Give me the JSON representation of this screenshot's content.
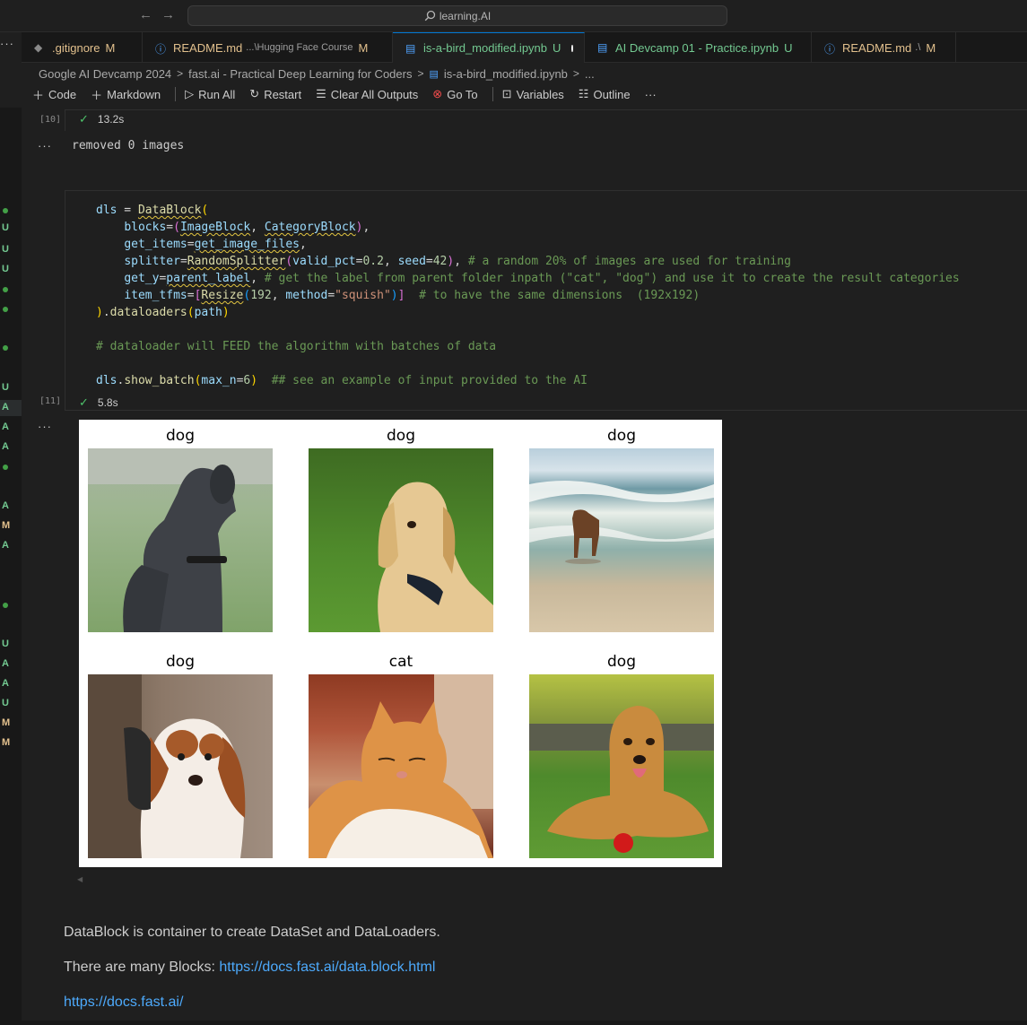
{
  "titlebar": {
    "back_arrow": "←",
    "forward_arrow": "→",
    "search_text": "learning.AI",
    "more": "···"
  },
  "tabs": [
    {
      "icon": "git-icon",
      "name": ".gitignore",
      "desc": "",
      "suffix": "M",
      "color": "#e2c08d",
      "active": false
    },
    {
      "icon": "info-icon",
      "name": "README.md",
      "desc": "...\\Hugging Face Course",
      "suffix": "M",
      "color": "#e2c08d",
      "active": false
    },
    {
      "icon": "notebook-icon",
      "name": "is-a-bird_modified.ipynb",
      "desc": "",
      "suffix": "U",
      "color": "#73c991",
      "active": true
    },
    {
      "icon": "notebook-icon",
      "name": "AI Devcamp 01 - Practice.ipynb",
      "desc": "",
      "suffix": "U",
      "color": "#73c991",
      "active": false
    },
    {
      "icon": "info-icon",
      "name": "README.md",
      "desc": ".\\",
      "suffix": "M",
      "color": "#e2c08d",
      "active": false
    }
  ],
  "breadcrumb": {
    "items": [
      "Google AI Devcamp 2024",
      "fast.ai - Practical Deep Learning for Coders",
      "is-a-bird_modified.ipynb",
      "..."
    ],
    "sep": ">"
  },
  "toolbar": {
    "code": "Code",
    "markdown": "Markdown",
    "run_all": "Run All",
    "restart": "Restart",
    "clear_outputs": "Clear All Outputs",
    "go_to": "Go To",
    "variables": "Variables",
    "outline": "Outline",
    "more": "···"
  },
  "cells": {
    "cell10": {
      "label": "[10]",
      "time": "13.2s",
      "output": "removed 0 images",
      "dots": "···"
    },
    "cell11": {
      "label": "[11]",
      "time": "5.8s",
      "dots": "···"
    }
  },
  "code_lines": {
    "l1_var": "dls",
    "l1_op": " = ",
    "l1_fn": "DataBlock",
    "l1_br": "(",
    "l2_param": "blocks",
    "l2_eq": "=",
    "l2_br": "(",
    "l2_a": "ImageBlock",
    "l2_comma": ", ",
    "l2_b": "CategoryBlock",
    "l2_br2": ")",
    "l2_end": ",",
    "l3_param": "get_items",
    "l3_eq": "=",
    "l3_val": "get_image_files",
    "l3_end": ",",
    "l4_param": "splitter",
    "l4_eq": "=",
    "l4_fn": "RandomSplitter",
    "l4_br": "(",
    "l4_p1": "valid_pct",
    "l4_eq2": "=",
    "l4_n1": "0.2",
    "l4_c": ", ",
    "l4_p2": "seed",
    "l4_eq3": "=",
    "l4_n2": "42",
    "l4_br2": ")",
    "l4_end": ", ",
    "l4_com": "# a random 20% of images are used for training",
    "l5_param": "get_y",
    "l5_eq": "=",
    "l5_val": "parent_label",
    "l5_end": ", ",
    "l5_com": "# get the label from parent folder inpath (\"cat\", \"dog\") and use it to create the result categories",
    "l6_param": "item_tfms",
    "l6_eq": "=",
    "l6_br": "[",
    "l6_fn": "Resize",
    "l6_br2": "(",
    "l6_n": "192",
    "l6_c": ", ",
    "l6_p": "method",
    "l6_eq2": "=",
    "l6_s": "\"squish\"",
    "l6_br3": ")",
    "l6_br4": "]",
    "l6_com": "  # to have the same dimensions  (192x192)",
    "l7_br": ")",
    "l7_dot": ".",
    "l7_fn": "dataloaders",
    "l7_br2": "(",
    "l7_arg": "path",
    "l7_br3": ")",
    "l8_com": "# dataloader will FEED the algorithm with batches of data",
    "l9_var": "dls",
    "l9_dot": ".",
    "l9_fn": "show_batch",
    "l9_br": "(",
    "l9_p": "max_n",
    "l9_eq": "=",
    "l9_n": "6",
    "l9_br2": ")",
    "l9_com": "  ## see an example of input provided to the AI"
  },
  "batch": [
    {
      "label": "dog",
      "desc": "great-dane"
    },
    {
      "label": "dog",
      "desc": "golden-puppy"
    },
    {
      "label": "dog",
      "desc": "dog-on-beach"
    },
    {
      "label": "dog",
      "desc": "spaniel-puppy"
    },
    {
      "label": "cat",
      "desc": "orange-cat"
    },
    {
      "label": "dog",
      "desc": "golden-retriever"
    }
  ],
  "markdown": {
    "line1": "DataBlock is container to create DataSet and DataLoaders.",
    "line2_text": "There are many Blocks: ",
    "line2_link": "https://docs.fast.ai/data.block.html",
    "line3_link": "https://docs.fast.ai/"
  },
  "gutter_marks": [
    "U",
    "U",
    "U",
    "U",
    "A",
    "A",
    "A",
    "M",
    "A",
    "U",
    "A",
    "A",
    "U",
    "M",
    "M"
  ]
}
